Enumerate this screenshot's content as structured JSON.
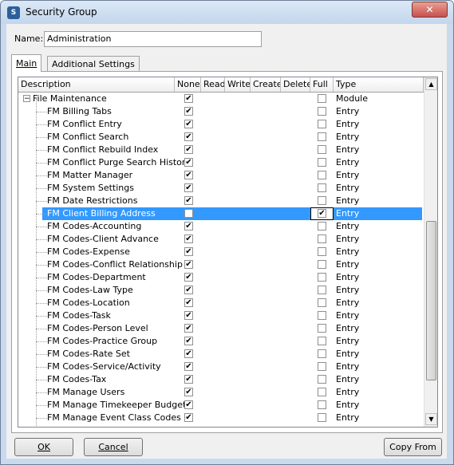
{
  "window": {
    "title": "Security Group",
    "icon": "app-icon",
    "close_label": "✕"
  },
  "name_label": "Name:",
  "name_value": "Administration",
  "tabs": [
    {
      "label": "Main",
      "active": true
    },
    {
      "label": "Additional Settings",
      "active": false
    }
  ],
  "columns": [
    "Description",
    "None",
    "Read",
    "Write",
    "Create",
    "Delete",
    "Full",
    "Type"
  ],
  "rows": [
    {
      "description": "File Maintenance",
      "none": true,
      "full": false,
      "type": "Module",
      "parent": true
    },
    {
      "description": "FM Billing Tabs",
      "none": true,
      "full": false,
      "type": "Entry"
    },
    {
      "description": "FM Conflict Entry",
      "none": true,
      "full": false,
      "type": "Entry"
    },
    {
      "description": "FM Conflict Search",
      "none": true,
      "full": false,
      "type": "Entry"
    },
    {
      "description": "FM Conflict Rebuild Index",
      "none": true,
      "full": false,
      "type": "Entry"
    },
    {
      "description": "FM Conflict Purge Search History",
      "none": true,
      "full": false,
      "type": "Entry"
    },
    {
      "description": "FM Matter Manager",
      "none": true,
      "full": false,
      "type": "Entry"
    },
    {
      "description": "FM System Settings",
      "none": true,
      "full": false,
      "type": "Entry"
    },
    {
      "description": "FM Date Restrictions",
      "none": true,
      "full": false,
      "type": "Entry"
    },
    {
      "description": "FM Client Billing Address",
      "none": false,
      "full": true,
      "type": "Entry",
      "selected": true
    },
    {
      "description": "FM Codes-Accounting",
      "none": true,
      "full": false,
      "type": "Entry"
    },
    {
      "description": "FM Codes-Client Advance",
      "none": true,
      "full": false,
      "type": "Entry"
    },
    {
      "description": "FM Codes-Expense",
      "none": true,
      "full": false,
      "type": "Entry"
    },
    {
      "description": "FM Codes-Conflict Relationship",
      "none": true,
      "full": false,
      "type": "Entry"
    },
    {
      "description": "FM Codes-Department",
      "none": true,
      "full": false,
      "type": "Entry"
    },
    {
      "description": "FM Codes-Law Type",
      "none": true,
      "full": false,
      "type": "Entry"
    },
    {
      "description": "FM Codes-Location",
      "none": true,
      "full": false,
      "type": "Entry"
    },
    {
      "description": "FM Codes-Task",
      "none": true,
      "full": false,
      "type": "Entry"
    },
    {
      "description": "FM Codes-Person Level",
      "none": true,
      "full": false,
      "type": "Entry"
    },
    {
      "description": "FM Codes-Practice Group",
      "none": true,
      "full": false,
      "type": "Entry"
    },
    {
      "description": "FM Codes-Rate Set",
      "none": true,
      "full": false,
      "type": "Entry"
    },
    {
      "description": "FM Codes-Service/Activity",
      "none": true,
      "full": false,
      "type": "Entry"
    },
    {
      "description": "FM Codes-Tax",
      "none": true,
      "full": false,
      "type": "Entry"
    },
    {
      "description": "FM Manage Users",
      "none": true,
      "full": false,
      "type": "Entry"
    },
    {
      "description": "FM Manage Timekeeper Budgets",
      "none": true,
      "full": false,
      "type": "Entry"
    },
    {
      "description": "FM Manage Event Class Codes",
      "none": true,
      "full": false,
      "type": "Entry"
    }
  ],
  "buttons": {
    "ok": "OK",
    "cancel": "Cancel",
    "copy_from": "Copy From"
  },
  "colors": {
    "selection": "#3399ff",
    "window_frame": "#c9daee"
  }
}
